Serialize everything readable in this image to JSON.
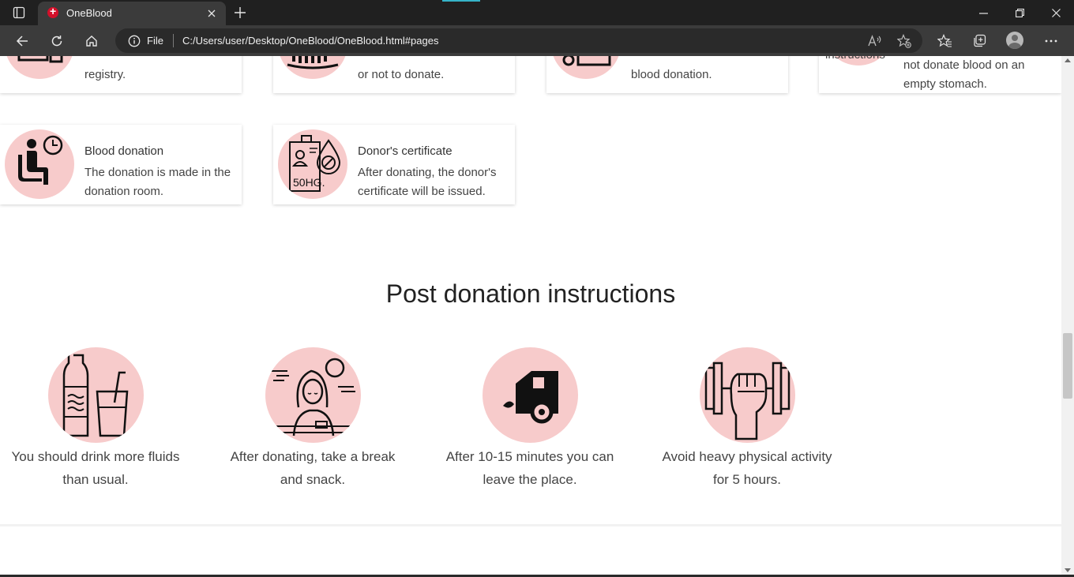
{
  "browser": {
    "tab_title": "OneBlood",
    "address_scheme": "File",
    "address_url": "C:/Users/user/Desktop/OneBlood/OneBlood.html#pages"
  },
  "steps_row1": [
    {
      "text": "registry."
    },
    {
      "text": "or not to donate."
    },
    {
      "text": "blood donation."
    },
    {
      "title_partial": "instructions",
      "text": "not donate blood on an empty stomach."
    }
  ],
  "steps_row2": [
    {
      "title": "Blood donation",
      "text": "The donation is made in the donation room.",
      "icon": "seated-donor-clock-icon"
    },
    {
      "title": "Donor's certificate",
      "text": "After donating, the donor's certificate will be issued.",
      "icon": "certificate-blood-drop-icon",
      "icon_label": "50HG."
    }
  ],
  "post_section": {
    "title": "Post donation instructions",
    "items": [
      {
        "text": "You should drink more fluids than usual.",
        "icon": "water-bottle-glass-icon"
      },
      {
        "text": "After donating, take a break and snack.",
        "icon": "woman-relaxing-icon"
      },
      {
        "text": "After 10-15 minutes you can leave the place.",
        "icon": "car-leaving-icon"
      },
      {
        "text": "Avoid heavy physical activity for 5 hours.",
        "icon": "dumbbell-fist-icon"
      }
    ]
  },
  "colors": {
    "icon_circle": "#f7cbcb",
    "browser_dark": "#202020",
    "favicon": "#d3102a"
  }
}
